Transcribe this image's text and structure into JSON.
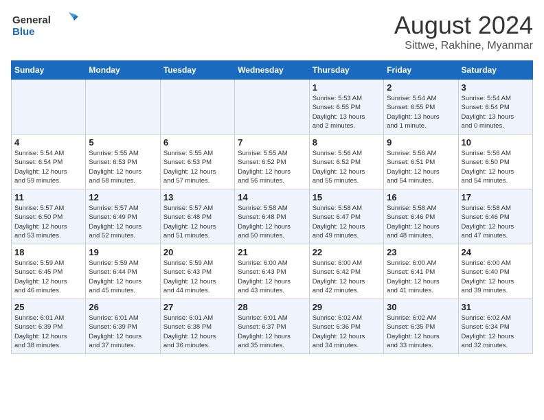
{
  "header": {
    "logo_general": "General",
    "logo_blue": "Blue",
    "month_year": "August 2024",
    "location": "Sittwe, Rakhine, Myanmar"
  },
  "weekdays": [
    "Sunday",
    "Monday",
    "Tuesday",
    "Wednesday",
    "Thursday",
    "Friday",
    "Saturday"
  ],
  "weeks": [
    [
      {
        "day": "",
        "details": ""
      },
      {
        "day": "",
        "details": ""
      },
      {
        "day": "",
        "details": ""
      },
      {
        "day": "",
        "details": ""
      },
      {
        "day": "1",
        "details": "Sunrise: 5:53 AM\nSunset: 6:55 PM\nDaylight: 13 hours\nand 2 minutes."
      },
      {
        "day": "2",
        "details": "Sunrise: 5:54 AM\nSunset: 6:55 PM\nDaylight: 13 hours\nand 1 minute."
      },
      {
        "day": "3",
        "details": "Sunrise: 5:54 AM\nSunset: 6:54 PM\nDaylight: 13 hours\nand 0 minutes."
      }
    ],
    [
      {
        "day": "4",
        "details": "Sunrise: 5:54 AM\nSunset: 6:54 PM\nDaylight: 12 hours\nand 59 minutes."
      },
      {
        "day": "5",
        "details": "Sunrise: 5:55 AM\nSunset: 6:53 PM\nDaylight: 12 hours\nand 58 minutes."
      },
      {
        "day": "6",
        "details": "Sunrise: 5:55 AM\nSunset: 6:53 PM\nDaylight: 12 hours\nand 57 minutes."
      },
      {
        "day": "7",
        "details": "Sunrise: 5:55 AM\nSunset: 6:52 PM\nDaylight: 12 hours\nand 56 minutes."
      },
      {
        "day": "8",
        "details": "Sunrise: 5:56 AM\nSunset: 6:52 PM\nDaylight: 12 hours\nand 55 minutes."
      },
      {
        "day": "9",
        "details": "Sunrise: 5:56 AM\nSunset: 6:51 PM\nDaylight: 12 hours\nand 54 minutes."
      },
      {
        "day": "10",
        "details": "Sunrise: 5:56 AM\nSunset: 6:50 PM\nDaylight: 12 hours\nand 54 minutes."
      }
    ],
    [
      {
        "day": "11",
        "details": "Sunrise: 5:57 AM\nSunset: 6:50 PM\nDaylight: 12 hours\nand 53 minutes."
      },
      {
        "day": "12",
        "details": "Sunrise: 5:57 AM\nSunset: 6:49 PM\nDaylight: 12 hours\nand 52 minutes."
      },
      {
        "day": "13",
        "details": "Sunrise: 5:57 AM\nSunset: 6:48 PM\nDaylight: 12 hours\nand 51 minutes."
      },
      {
        "day": "14",
        "details": "Sunrise: 5:58 AM\nSunset: 6:48 PM\nDaylight: 12 hours\nand 50 minutes."
      },
      {
        "day": "15",
        "details": "Sunrise: 5:58 AM\nSunset: 6:47 PM\nDaylight: 12 hours\nand 49 minutes."
      },
      {
        "day": "16",
        "details": "Sunrise: 5:58 AM\nSunset: 6:46 PM\nDaylight: 12 hours\nand 48 minutes."
      },
      {
        "day": "17",
        "details": "Sunrise: 5:58 AM\nSunset: 6:46 PM\nDaylight: 12 hours\nand 47 minutes."
      }
    ],
    [
      {
        "day": "18",
        "details": "Sunrise: 5:59 AM\nSunset: 6:45 PM\nDaylight: 12 hours\nand 46 minutes."
      },
      {
        "day": "19",
        "details": "Sunrise: 5:59 AM\nSunset: 6:44 PM\nDaylight: 12 hours\nand 45 minutes."
      },
      {
        "day": "20",
        "details": "Sunrise: 5:59 AM\nSunset: 6:43 PM\nDaylight: 12 hours\nand 44 minutes."
      },
      {
        "day": "21",
        "details": "Sunrise: 6:00 AM\nSunset: 6:43 PM\nDaylight: 12 hours\nand 43 minutes."
      },
      {
        "day": "22",
        "details": "Sunrise: 6:00 AM\nSunset: 6:42 PM\nDaylight: 12 hours\nand 42 minutes."
      },
      {
        "day": "23",
        "details": "Sunrise: 6:00 AM\nSunset: 6:41 PM\nDaylight: 12 hours\nand 41 minutes."
      },
      {
        "day": "24",
        "details": "Sunrise: 6:00 AM\nSunset: 6:40 PM\nDaylight: 12 hours\nand 39 minutes."
      }
    ],
    [
      {
        "day": "25",
        "details": "Sunrise: 6:01 AM\nSunset: 6:39 PM\nDaylight: 12 hours\nand 38 minutes."
      },
      {
        "day": "26",
        "details": "Sunrise: 6:01 AM\nSunset: 6:39 PM\nDaylight: 12 hours\nand 37 minutes."
      },
      {
        "day": "27",
        "details": "Sunrise: 6:01 AM\nSunset: 6:38 PM\nDaylight: 12 hours\nand 36 minutes."
      },
      {
        "day": "28",
        "details": "Sunrise: 6:01 AM\nSunset: 6:37 PM\nDaylight: 12 hours\nand 35 minutes."
      },
      {
        "day": "29",
        "details": "Sunrise: 6:02 AM\nSunset: 6:36 PM\nDaylight: 12 hours\nand 34 minutes."
      },
      {
        "day": "30",
        "details": "Sunrise: 6:02 AM\nSunset: 6:35 PM\nDaylight: 12 hours\nand 33 minutes."
      },
      {
        "day": "31",
        "details": "Sunrise: 6:02 AM\nSunset: 6:34 PM\nDaylight: 12 hours\nand 32 minutes."
      }
    ]
  ]
}
